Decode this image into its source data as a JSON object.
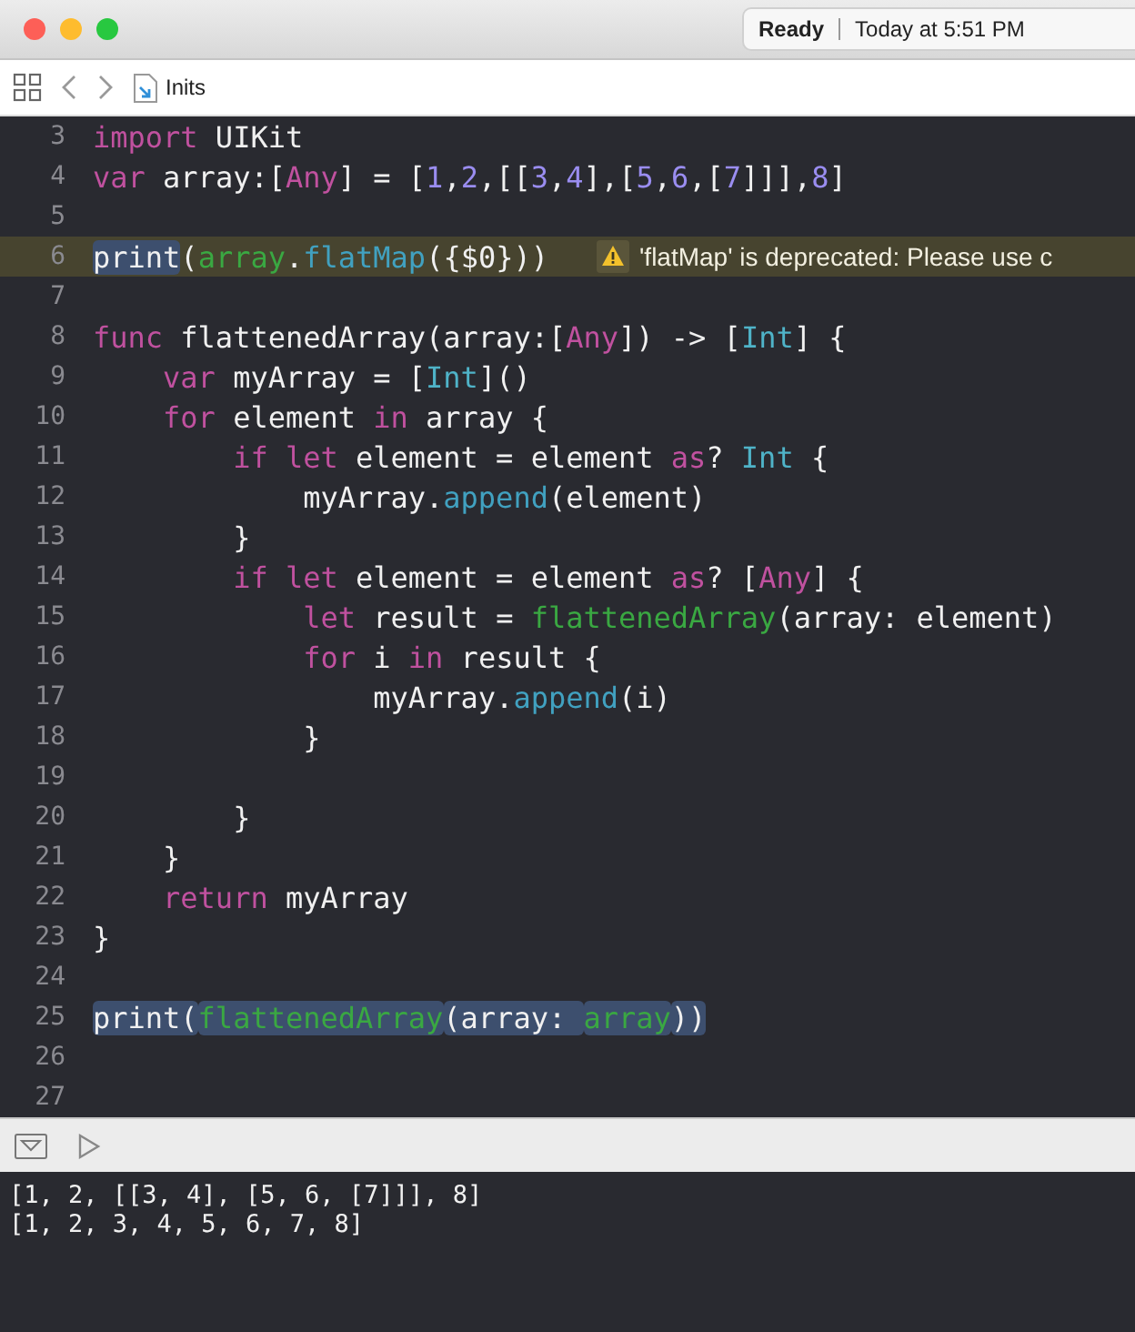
{
  "window": {
    "status": {
      "state": "Ready",
      "time": "Today at 5:51 PM"
    }
  },
  "breadcrumb": {
    "file": "Inits"
  },
  "editor": {
    "lines": [
      {
        "number": "3",
        "tokens": [
          {
            "kind": "keyword",
            "text": "import",
            "selected": false
          },
          {
            "kind": "plain",
            "text": " UIKit",
            "selected": false
          }
        ]
      },
      {
        "number": "4",
        "tokens": [
          {
            "kind": "keyword",
            "text": "var",
            "selected": false
          },
          {
            "kind": "plain",
            "text": " array:[",
            "selected": false
          },
          {
            "kind": "keyword",
            "text": "Any",
            "selected": false
          },
          {
            "kind": "plain",
            "text": "] = [",
            "selected": false
          },
          {
            "kind": "number",
            "text": "1",
            "selected": false
          },
          {
            "kind": "plain",
            "text": ",",
            "selected": false
          },
          {
            "kind": "number",
            "text": "2",
            "selected": false
          },
          {
            "kind": "plain",
            "text": ",[[",
            "selected": false
          },
          {
            "kind": "number",
            "text": "3",
            "selected": false
          },
          {
            "kind": "plain",
            "text": ",",
            "selected": false
          },
          {
            "kind": "number",
            "text": "4",
            "selected": false
          },
          {
            "kind": "plain",
            "text": "],[",
            "selected": false
          },
          {
            "kind": "number",
            "text": "5",
            "selected": false
          },
          {
            "kind": "plain",
            "text": ",",
            "selected": false
          },
          {
            "kind": "number",
            "text": "6",
            "selected": false
          },
          {
            "kind": "plain",
            "text": ",[",
            "selected": false
          },
          {
            "kind": "number",
            "text": "7",
            "selected": false
          },
          {
            "kind": "plain",
            "text": "]]],",
            "selected": false
          },
          {
            "kind": "number",
            "text": "8",
            "selected": false
          },
          {
            "kind": "plain",
            "text": "]",
            "selected": false
          }
        ]
      },
      {
        "number": "5"
      },
      {
        "number": "6",
        "tokens": [
          {
            "kind": "plain",
            "text": "print",
            "selected": true
          },
          {
            "kind": "plain",
            "text": "(",
            "selected": false
          },
          {
            "kind": "function",
            "text": "array",
            "selected": false
          },
          {
            "kind": "plain",
            "text": ".",
            "selected": false
          },
          {
            "kind": "method",
            "text": "flatMap",
            "selected": false
          },
          {
            "kind": "plain",
            "text": "({$0}))",
            "selected": false
          }
        ],
        "warning": {
          "message": "'flatMap' is deprecated: Please use c"
        }
      },
      {
        "number": "7"
      },
      {
        "number": "8",
        "tokens": [
          {
            "kind": "keyword",
            "text": "func",
            "selected": false
          },
          {
            "kind": "plain",
            "text": " flattenedArray(array:[",
            "selected": false
          },
          {
            "kind": "keyword",
            "text": "Any",
            "selected": false
          },
          {
            "kind": "plain",
            "text": "]) -> [",
            "selected": false
          },
          {
            "kind": "type",
            "text": "Int",
            "selected": false
          },
          {
            "kind": "plain",
            "text": "] {",
            "selected": false
          }
        ]
      },
      {
        "number": "9",
        "tokens": [
          {
            "kind": "keyword",
            "text": "    var",
            "selected": false
          },
          {
            "kind": "plain",
            "text": " myArray = [",
            "selected": false
          },
          {
            "kind": "type",
            "text": "Int",
            "selected": false
          },
          {
            "kind": "plain",
            "text": "]()",
            "selected": false
          }
        ]
      },
      {
        "number": "10",
        "tokens": [
          {
            "kind": "keyword",
            "text": "    for",
            "selected": false
          },
          {
            "kind": "plain",
            "text": " element ",
            "selected": false
          },
          {
            "kind": "keyword",
            "text": "in",
            "selected": false
          },
          {
            "kind": "plain",
            "text": " array {",
            "selected": false
          }
        ]
      },
      {
        "number": "11",
        "tokens": [
          {
            "kind": "keyword",
            "text": "        if let",
            "selected": false
          },
          {
            "kind": "plain",
            "text": " element = element ",
            "selected": false
          },
          {
            "kind": "keyword",
            "text": "as",
            "selected": false
          },
          {
            "kind": "plain",
            "text": "? ",
            "selected": false
          },
          {
            "kind": "type",
            "text": "Int",
            "selected": false
          },
          {
            "kind": "plain",
            "text": " {",
            "selected": false
          }
        ]
      },
      {
        "number": "12",
        "tokens": [
          {
            "kind": "plain",
            "text": "            myArray.",
            "selected": false
          },
          {
            "kind": "method",
            "text": "append",
            "selected": false
          },
          {
            "kind": "plain",
            "text": "(element)",
            "selected": false
          }
        ]
      },
      {
        "number": "13",
        "tokens": [
          {
            "kind": "plain",
            "text": "        }",
            "selected": false
          }
        ]
      },
      {
        "number": "14",
        "tokens": [
          {
            "kind": "keyword",
            "text": "        if let",
            "selected": false
          },
          {
            "kind": "plain",
            "text": " element = element ",
            "selected": false
          },
          {
            "kind": "keyword",
            "text": "as",
            "selected": false
          },
          {
            "kind": "plain",
            "text": "? [",
            "selected": false
          },
          {
            "kind": "keyword",
            "text": "Any",
            "selected": false
          },
          {
            "kind": "plain",
            "text": "] {",
            "selected": false
          }
        ]
      },
      {
        "number": "15",
        "tokens": [
          {
            "kind": "keyword",
            "text": "            let",
            "selected": false
          },
          {
            "kind": "plain",
            "text": " result = ",
            "selected": false
          },
          {
            "kind": "function",
            "text": "flattenedArray",
            "selected": false
          },
          {
            "kind": "plain",
            "text": "(array: element)",
            "selected": false
          }
        ]
      },
      {
        "number": "16",
        "tokens": [
          {
            "kind": "keyword",
            "text": "            for",
            "selected": false
          },
          {
            "kind": "plain",
            "text": " i ",
            "selected": false
          },
          {
            "kind": "keyword",
            "text": "in",
            "selected": false
          },
          {
            "kind": "plain",
            "text": " result {",
            "selected": false
          }
        ]
      },
      {
        "number": "17",
        "tokens": [
          {
            "kind": "plain",
            "text": "                myArray.",
            "selected": false
          },
          {
            "kind": "method",
            "text": "append",
            "selected": false
          },
          {
            "kind": "plain",
            "text": "(i)",
            "selected": false
          }
        ]
      },
      {
        "number": "18",
        "tokens": [
          {
            "kind": "plain",
            "text": "            }",
            "selected": false
          }
        ]
      },
      {
        "number": "19"
      },
      {
        "number": "20",
        "tokens": [
          {
            "kind": "plain",
            "text": "        }",
            "selected": false
          }
        ]
      },
      {
        "number": "21",
        "tokens": [
          {
            "kind": "plain",
            "text": "    }",
            "selected": false
          }
        ]
      },
      {
        "number": "22",
        "tokens": [
          {
            "kind": "keyword",
            "text": "    return",
            "selected": false
          },
          {
            "kind": "plain",
            "text": " myArray",
            "selected": false
          }
        ]
      },
      {
        "number": "23",
        "tokens": [
          {
            "kind": "plain",
            "text": "}",
            "selected": false
          }
        ]
      },
      {
        "number": "24"
      },
      {
        "number": "25",
        "tokens": [
          {
            "kind": "plain",
            "text": "print(",
            "selected": true
          },
          {
            "kind": "function",
            "text": "flattenedArray",
            "selected": true
          },
          {
            "kind": "plain",
            "text": "(array: ",
            "selected": true
          },
          {
            "kind": "function",
            "text": "array",
            "selected": true
          },
          {
            "kind": "plain",
            "text": "))",
            "selected": true
          }
        ]
      },
      {
        "number": "26"
      },
      {
        "number": "27"
      }
    ]
  },
  "console": {
    "output": [
      "[1, 2, [[3, 4], [5, 6, [7]]], 8]",
      "[1, 2, 3, 4, 5, 6, 7, 8]"
    ]
  }
}
